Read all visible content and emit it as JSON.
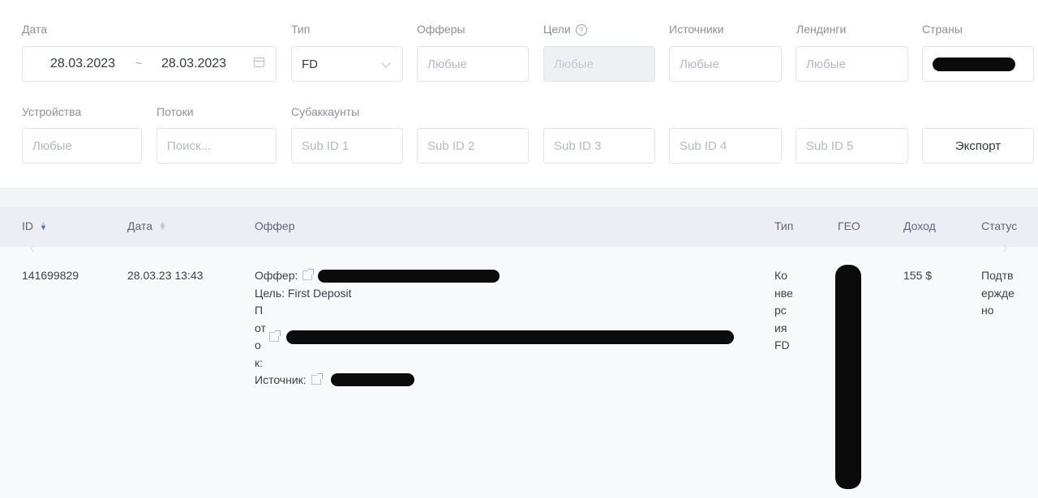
{
  "filters": {
    "date": {
      "label": "Дата",
      "from": "28.03.2023",
      "separator": "~",
      "to": "28.03.2023"
    },
    "type": {
      "label": "Тип",
      "value": "FD"
    },
    "offers": {
      "label": "Офферы",
      "placeholder": "Любые"
    },
    "goals": {
      "label": "Цели",
      "placeholder": "Любые"
    },
    "sources": {
      "label": "Источники",
      "placeholder": "Любые"
    },
    "landings": {
      "label": "Лендинги",
      "placeholder": "Любые"
    },
    "countries": {
      "label": "Страны"
    },
    "devices": {
      "label": "Устройства",
      "placeholder": "Любые"
    },
    "streams": {
      "label": "Потоки",
      "placeholder": "Поиск..."
    },
    "subaccounts": {
      "label": "Субаккаунты"
    },
    "sub_ids": [
      "Sub ID 1",
      "Sub ID 2",
      "Sub ID 3",
      "Sub ID 4",
      "Sub ID 5"
    ],
    "export_label": "Экспорт"
  },
  "table": {
    "columns": [
      "ID",
      "Дата",
      "Оффер",
      "Тип",
      "ГЕО",
      "Доход",
      "Статус"
    ],
    "rows": [
      {
        "id": "141699829",
        "date": "28.03.23 13:43",
        "offer_label": "Оффер:",
        "goal": "Цель: First Deposit",
        "stream_label": [
          "П",
          "от",
          "о",
          "к:"
        ],
        "source_label": "Источник:",
        "type": [
          "Ко",
          "нве",
          "рс",
          "ия",
          "FD"
        ],
        "income": "155 $",
        "status": [
          "Подтв",
          "ержде",
          "но"
        ]
      }
    ]
  },
  "icons": {
    "calendar": "calendar-icon",
    "chevron": "chevron-down-icon",
    "help": "help-icon",
    "sort": "sort-icon",
    "external_link": "external-link-icon"
  },
  "colors": {
    "accent": "#3b6fe0",
    "header_bg": "#eceef3",
    "row_bg": "#f8f9fb"
  }
}
